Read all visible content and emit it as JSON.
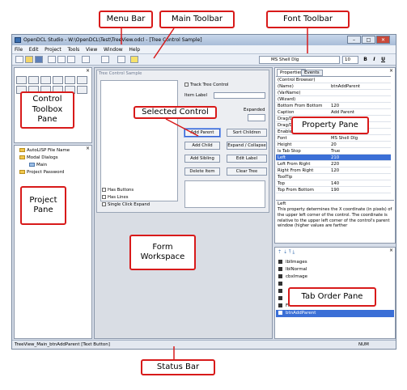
{
  "window": {
    "title": "OpenDCL Studio - W:\\OpenDCL\\Test\\TreeView.odcl - [Tree Control Sample]"
  },
  "menu": [
    "File",
    "Edit",
    "Project",
    "Tools",
    "View",
    "Window",
    "Help"
  ],
  "font_toolbar": {
    "font": "MS Shell Dlg",
    "size": "10",
    "bold": "B",
    "italic": "I",
    "underline": "U"
  },
  "project_tree": [
    "AutoLISP File Name",
    "Modal Dialogs",
    "Main",
    "Project Password"
  ],
  "form": {
    "title": "Tree Control Sample",
    "track_tree_control": "Track Tree Control",
    "item_label": "Item Label",
    "expanded": "Expanded",
    "buttons": [
      "Add Parent",
      "Sort Children",
      "Add Child",
      "Expand / Collapse",
      "Add Sibling",
      "Edit Label",
      "Delete Item",
      "Clear Tree"
    ],
    "checkboxes": [
      "Has Buttons",
      "Has Lines",
      "Single Click Expand"
    ]
  },
  "properties": {
    "tabs": [
      "Properties",
      "Events"
    ],
    "rows": [
      [
        "(Control Browser)",
        ""
      ],
      [
        "(Name)",
        "btnAddParent"
      ],
      [
        "(VarName)",
        ""
      ],
      [
        "(Wizard)",
        ""
      ],
      [
        "Bottom From Bottom",
        "120"
      ],
      [
        "Caption",
        "Add Parent"
      ],
      [
        "Drag/Drop",
        ""
      ],
      [
        "Drag/Drop",
        ""
      ],
      [
        "Enabled",
        "True"
      ],
      [
        "Font",
        "MS Shell Dlg"
      ],
      [
        "Height",
        "20"
      ],
      [
        "Is Tab Stop",
        "True"
      ],
      [
        "Left",
        "210"
      ],
      [
        "Left From Right",
        "220"
      ],
      [
        "Right From Right",
        "120"
      ],
      [
        "ToolTip",
        ""
      ],
      [
        "Top",
        "140"
      ],
      [
        "Top From Bottom",
        "190"
      ]
    ],
    "desc_title": "Left",
    "desc_text": "This property determines the X coordinate (in pixels) of the upper left corner of the control. The coordinate is relative to the upper left corner of the control's parent window (higher values are farther"
  },
  "tab_order": [
    "lblImages",
    "lblNormal",
    "cbxImage",
    "",
    "",
    "",
    "Frame1",
    "btnAddParent"
  ],
  "status": {
    "text": "TreeView_Main_btnAddParent [Text Button]",
    "num": "NUM"
  },
  "callouts": {
    "menu_bar": "Menu Bar",
    "main_toolbar": "Main Toolbar",
    "font_toolbar": "Font Toolbar",
    "control_toolbox": "Control Toolbox Pane",
    "selected_control": "Selected Control",
    "property_pane": "Property Pane",
    "project_pane": "Project Pane",
    "form_workspace": "Form Workspace",
    "tab_order_pane": "Tab Order Pane",
    "status_bar": "Status Bar"
  }
}
